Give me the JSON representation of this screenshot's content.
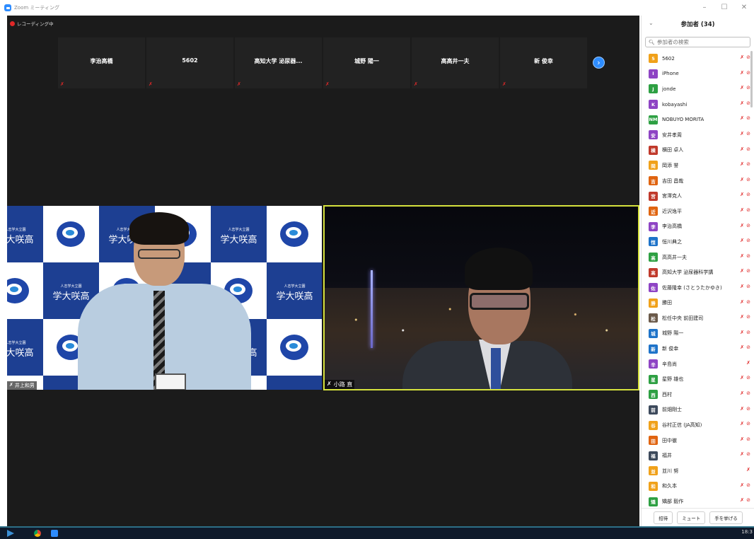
{
  "window": {
    "title": "Zoom ミーティング",
    "controls": [
      "–",
      "☐",
      "✕"
    ]
  },
  "meeting": {
    "recording_label": "レコーディング中",
    "thumbnails": [
      {
        "name": "李治高橋"
      },
      {
        "name": "5602"
      },
      {
        "name": "高知大学 泌尿器..."
      },
      {
        "name": "城野 陽一"
      },
      {
        "name": "高高井一夫"
      },
      {
        "name": "新 俊幸"
      }
    ],
    "next_page_icon": "›",
    "background_small_text": "人志学大立園",
    "background_big_text": "学大咲高",
    "video_left_name": "井上和男",
    "video_right_name": "小路 直"
  },
  "participants": {
    "title": "参加者 (34)",
    "collapse_icon": "⌄",
    "search_placeholder": "参加者の検索",
    "items": [
      {
        "initial": "5",
        "name": "5602",
        "color": "#f0a11a",
        "video_off": true
      },
      {
        "initial": "I",
        "name": "iPhone",
        "color": "#8e44c4",
        "video_off": true
      },
      {
        "initial": "J",
        "name": "jonde",
        "color": "#2ea043",
        "video_off": true
      },
      {
        "initial": "K",
        "name": "kobayashi",
        "color": "#8e44c4",
        "video_off": true
      },
      {
        "initial": "NM",
        "name": "NOBUYO MORITA",
        "color": "#2ea043",
        "video_off": true
      },
      {
        "initial": "安",
        "name": "安井孝周",
        "color": "#8e44c4",
        "video_off": true
      },
      {
        "initial": "横",
        "name": "横田 卓人",
        "color": "#c0392b",
        "video_off": true
      },
      {
        "initial": "岡",
        "name": "岡添 誉",
        "color": "#f0a11a",
        "video_off": true
      },
      {
        "initial": "吉",
        "name": "吉田 昌哉",
        "color": "#e06410",
        "video_off": true
      },
      {
        "initial": "宮",
        "name": "宮澤克人",
        "color": "#c0392b",
        "video_off": true
      },
      {
        "initial": "近",
        "name": "近沢逸平",
        "color": "#e06410",
        "video_off": true
      },
      {
        "initial": "李",
        "name": "李治高橋",
        "color": "#8e44c4",
        "video_off": true
      },
      {
        "initial": "恒",
        "name": "恒川典之",
        "color": "#1e73c9",
        "video_off": true
      },
      {
        "initial": "高",
        "name": "高高井一夫",
        "color": "#2ea043",
        "video_off": true
      },
      {
        "initial": "高",
        "name": "高知大学 泌尿器科学講",
        "color": "#c0392b",
        "video_off": true
      },
      {
        "initial": "佐",
        "name": "佐藤隆幸 (さとうたかゆき)",
        "color": "#8e44c4",
        "video_off": true
      },
      {
        "initial": "勝",
        "name": "勝田",
        "color": "#f0a11a",
        "video_off": true
      },
      {
        "initial": "松",
        "name": "松任中央 前田建司",
        "color": "#6b5a4a",
        "video_off": true
      },
      {
        "initial": "城",
        "name": "城野 陽一",
        "color": "#1e73c9",
        "video_off": true
      },
      {
        "initial": "新",
        "name": "新 俊幸",
        "color": "#1e73c9",
        "video_off": true
      },
      {
        "initial": "辛",
        "name": "辛島尚",
        "color": "#8e44c4",
        "video_off": false
      },
      {
        "initial": "星",
        "name": "星野 雄也",
        "color": "#2ea043",
        "video_off": true
      },
      {
        "initial": "西",
        "name": "西村",
        "color": "#2ea043",
        "video_off": true
      },
      {
        "initial": "前",
        "name": "前畑剛士",
        "color": "#3d4a5c",
        "video_off": true
      },
      {
        "initial": "谷",
        "name": "谷村正信 (JA高知)",
        "color": "#f0a11a",
        "video_off": true
      },
      {
        "initial": "田",
        "name": "田中徹",
        "color": "#e06410",
        "video_off": true
      },
      {
        "initial": "福",
        "name": "福井",
        "color": "#3d4a5c",
        "video_off": true
      },
      {
        "initial": "並",
        "name": "並川 努",
        "color": "#f0a11a",
        "video_off": false
      },
      {
        "initial": "和",
        "name": "和久本",
        "color": "#f0a11a",
        "video_off": true
      },
      {
        "initial": "矯",
        "name": "矯部 毅作",
        "color": "#2ea043",
        "video_off": true
      }
    ],
    "footer": {
      "invite": "招待",
      "mute": "ミュート",
      "raise_hand": "手を挙げる"
    }
  },
  "taskbar": {
    "clock": "18:3"
  }
}
